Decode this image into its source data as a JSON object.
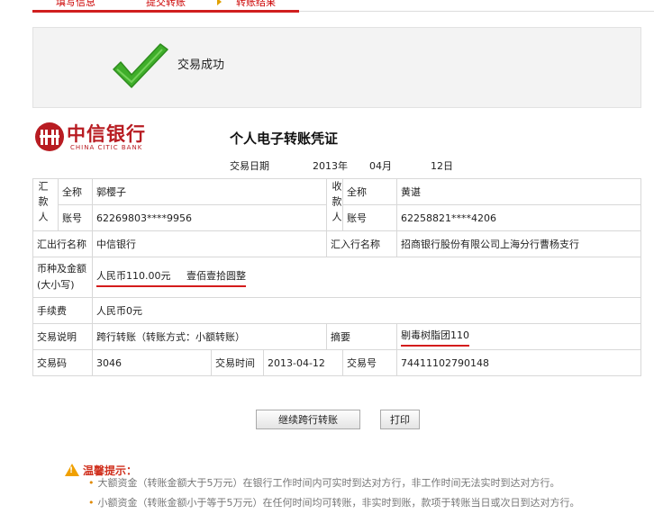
{
  "steps": {
    "step1": "填写信息",
    "step2": "提交转账",
    "step3": "转账结果"
  },
  "status": {
    "message": "交易成功"
  },
  "bank": {
    "name_cn": "中信银行",
    "name_en": "CHINA CITIC BANK"
  },
  "voucher": {
    "title": "个人电子转账凭证",
    "date_label": "交易日期",
    "year": "2013年",
    "month": "04月",
    "day": "12日"
  },
  "payer": {
    "side_label": "汇款人",
    "name_label": "全称",
    "name": "郭樱子",
    "account_label": "账号",
    "account": "62269803****9956",
    "bank_label": "汇出行名称",
    "bank": "中信银行"
  },
  "payee": {
    "side_label": "收款人",
    "name_label": "全称",
    "name": "黄谌",
    "account_label": "账号",
    "account": "62258821****4206",
    "bank_label": "汇入行名称",
    "bank": "招商银行股份有限公司上海分行曹杨支行"
  },
  "amount": {
    "label_line1": "币种及金额",
    "label_line2": "(大小写)",
    "numeric": "人民币110.00元",
    "words": "壹佰壹拾圆整"
  },
  "fee": {
    "label": "手续费",
    "value": "人民币0元"
  },
  "description": {
    "label": "交易说明",
    "value": "跨行转账（转账方式：小额转账）"
  },
  "memo": {
    "label": "摘要",
    "value": "剔毒树脂团110"
  },
  "txn": {
    "code_label": "交易码",
    "code": "3046",
    "time_label": "交易时间",
    "time": "2013-04-12",
    "no_label": "交易号",
    "no": "74411102790148"
  },
  "buttons": {
    "continue": "继续跨行转账",
    "print": "打印"
  },
  "tips": {
    "title": "温馨提示：",
    "line1": "大额资金（转账金额大于5万元）在银行工作时间内可实时到达对方行，非工作时间无法实时到达对方行。",
    "line2": "小额资金（转账金额小于等于5万元）在任何时间均可转账，非实时到账，款项于转账当日或次日到达对方行。"
  },
  "colors": {
    "accent": "#d41c1c",
    "brand": "#b81c22",
    "check": "#3fae2a",
    "warn": "#f0a000"
  }
}
